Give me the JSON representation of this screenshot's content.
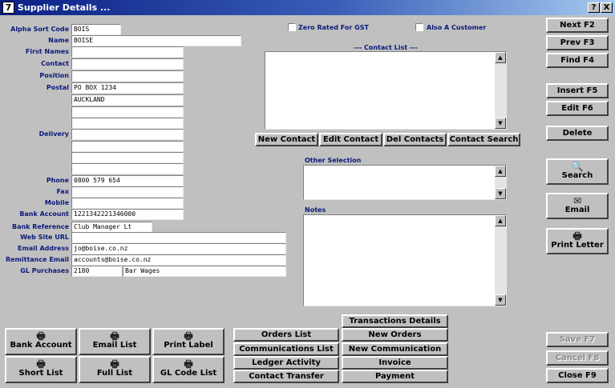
{
  "window": {
    "title": "Supplier Details ...",
    "help_btn": "?",
    "close_btn": "X",
    "app_icon": "7"
  },
  "labels": {
    "alpha_sort_code": "Alpha Sort Code",
    "name": "Name",
    "first_names": "First Names",
    "contact": "Contact",
    "position": "Position",
    "postal": "Postal",
    "delivery": "Delivery",
    "phone": "Phone",
    "fax": "Fax",
    "mobile": "Mobile",
    "bank_account": "Bank Account",
    "bank_reference": "Bank Reference",
    "web_site_url": "Web Site URL",
    "email_address": "Email Address",
    "remittance_email": "Remittance Email",
    "gl_purchases": "GL Purchases"
  },
  "fields": {
    "alpha_sort_code": "BOIS",
    "name": "BOISE",
    "first_names": "",
    "contact": "",
    "position": "",
    "postal": [
      "PO BOX 1234",
      "AUCKLAND",
      "",
      ""
    ],
    "delivery": [
      "",
      "",
      "",
      ""
    ],
    "phone": "0800 579 654",
    "fax": "",
    "mobile": "",
    "bank_account": "1221342221346000",
    "bank_reference": "Club Manager Lt",
    "web_site_url": "",
    "email_address": "jo@boise.co.nz",
    "remittance_email": "accounts@boise.co.nz",
    "gl_purchases_code": "2180",
    "gl_purchases_name": "Bar Wages"
  },
  "checkboxes": {
    "zero_rated_gst": "Zero Rated For GST",
    "also_customer": "Also A Customer"
  },
  "contact_list": {
    "title": "--- Contact List ---",
    "buttons": {
      "new": "New Contact",
      "edit": "Edit Contact",
      "del": "Del Contacts",
      "search": "Contact Search"
    }
  },
  "other_selection": {
    "title": "Other Selection"
  },
  "notes": {
    "title": "Notes"
  },
  "right_buttons": {
    "next": "Next F2",
    "prev": "Prev F3",
    "find": "Find F4",
    "insert": "Insert F5",
    "edit": "Edit F6",
    "delete": "Delete",
    "search": "Search",
    "email": "Email",
    "print_letter": "Print Letter",
    "save": "Save F7",
    "cancel": "Cancel F8",
    "close": "Close F9"
  },
  "bottom_buttons": {
    "bank_account": "Bank Account",
    "email_list": "Email List",
    "print_label": "Print Label",
    "short_list": "Short List",
    "full_list": "Full List",
    "gl_code_list": "GL Code List",
    "orders_list": "Orders List",
    "communications_list": "Communications List",
    "ledger_activity": "Ledger Activity",
    "contact_transfer": "Contact Transfer",
    "transactions_details": "Transactions Details",
    "new_orders": "New Orders",
    "new_communication": "New Communication",
    "invoice": "Invoice",
    "payment": "Payment"
  },
  "icons": {
    "printer": "🖶",
    "search": "🔍",
    "email": "✉"
  }
}
